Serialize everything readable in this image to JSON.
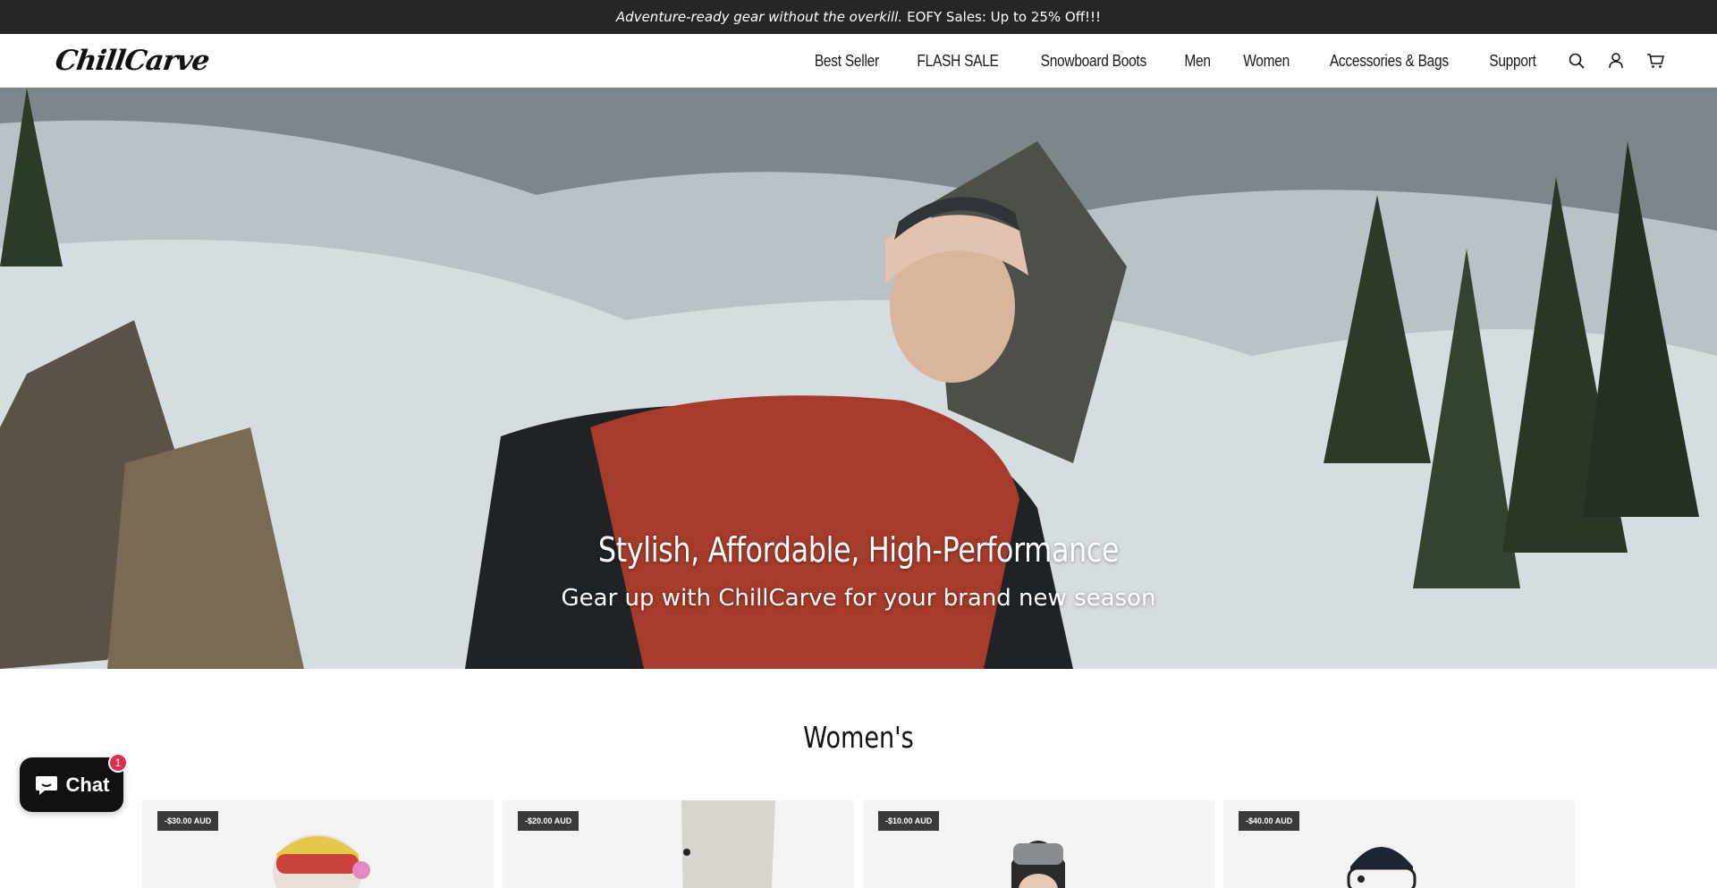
{
  "announcement": {
    "italic_text": "Adventure-ready gear without the overkill.",
    "text": "EOFY Sales: Up to 25% Off!!!"
  },
  "header": {
    "logo_text": "ChillCarve",
    "nav": [
      {
        "label": "Best Seller"
      },
      {
        "label": "FLASH SALE"
      },
      {
        "label": "Snowboard Boots"
      },
      {
        "label": "Men"
      },
      {
        "label": "Women"
      },
      {
        "label": "Accessories & Bags"
      },
      {
        "label": "Support"
      }
    ],
    "icons": [
      "search-icon",
      "account-icon",
      "cart-icon"
    ]
  },
  "hero": {
    "title": "Stylish, Affordable, High-Performance",
    "subtitle": "Gear up with ChillCarve for your brand new season"
  },
  "section": {
    "title": "Women's",
    "products": [
      {
        "badge": "-$30.00 AUD"
      },
      {
        "badge": "-$20.00 AUD"
      },
      {
        "badge": "-$10.00 AUD"
      },
      {
        "badge": "-$40.00 AUD"
      }
    ]
  },
  "chat": {
    "label": "Chat",
    "count": "1"
  },
  "colors": {
    "announce_bg": "#262626",
    "badge_bg": "#3a3a3a",
    "chat_bg": "#111111",
    "notification": "#e22c4c"
  }
}
